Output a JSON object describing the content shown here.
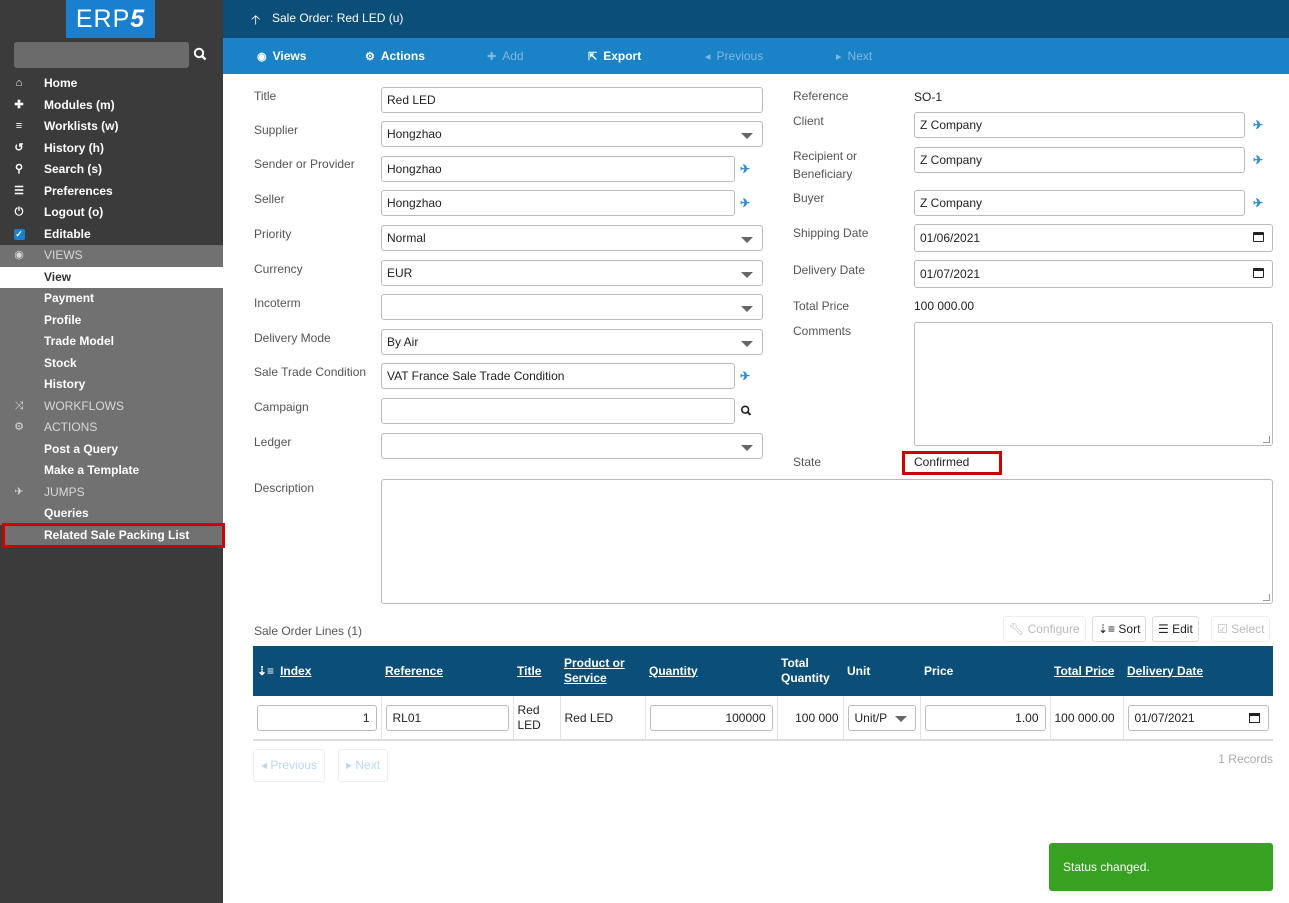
{
  "logo": {
    "text_main": "ERP",
    "text_accent": "5"
  },
  "sidebar": {
    "search_placeholder": "",
    "items": [
      {
        "label": "Home",
        "icon": "home-icon",
        "glyph": "⌂"
      },
      {
        "label": "Modules (m)",
        "icon": "puzzle-icon",
        "glyph": "✚"
      },
      {
        "label": "Worklists (w)",
        "icon": "worklist-icon",
        "glyph": "≡"
      },
      {
        "label": "History (h)",
        "icon": "history-icon",
        "glyph": "↺"
      },
      {
        "label": "Search (s)",
        "icon": "search-icon",
        "glyph": "⚲"
      },
      {
        "label": "Preferences",
        "icon": "sliders-icon",
        "glyph": "☰"
      },
      {
        "label": "Logout (o)",
        "icon": "power-icon",
        "glyph": "⏻"
      },
      {
        "label": "Editable",
        "icon": "checkbox-icon",
        "glyph": "✓"
      }
    ],
    "views_section": {
      "label": "VIEWS",
      "icon": "eye-icon",
      "glyph": "◉"
    },
    "views": [
      "View",
      "Payment",
      "Profile",
      "Trade Model",
      "Stock",
      "History"
    ],
    "workflows_section": {
      "label": "WORKFLOWS",
      "icon": "shuffle-icon",
      "glyph": "⤨"
    },
    "actions_section": {
      "label": "ACTIONS",
      "icon": "gears-icon",
      "glyph": "⚙"
    },
    "actions": [
      "Post a Query",
      "Make a Template"
    ],
    "jumps_section": {
      "label": "JUMPS",
      "icon": "plane-icon",
      "glyph": "✈"
    },
    "jumps": [
      "Queries",
      "Related Sale Packing List"
    ]
  },
  "header": {
    "title": "Sale Order: Red LED (u)"
  },
  "toolbar": {
    "views": "Views",
    "actions": "Actions",
    "add": "Add",
    "export": "Export",
    "previous": "Previous",
    "next": "Next"
  },
  "form": {
    "left": {
      "title": {
        "label": "Title",
        "value": "Red LED"
      },
      "supplier": {
        "label": "Supplier",
        "value": "Hongzhao"
      },
      "sender": {
        "label": "Sender or Provider",
        "value": "Hongzhao"
      },
      "seller": {
        "label": "Seller",
        "value": "Hongzhao"
      },
      "priority": {
        "label": "Priority",
        "value": "Normal"
      },
      "currency": {
        "label": "Currency",
        "value": "EUR"
      },
      "incoterm": {
        "label": "Incoterm",
        "value": ""
      },
      "delivery_mode": {
        "label": "Delivery Mode",
        "value": "By Air"
      },
      "trade_condition": {
        "label": "Sale Trade Condition",
        "value": "VAT France Sale Trade Condition"
      },
      "campaign": {
        "label": "Campaign",
        "value": ""
      },
      "ledger": {
        "label": "Ledger",
        "value": ""
      },
      "description": {
        "label": "Description",
        "value": ""
      }
    },
    "right": {
      "reference": {
        "label": "Reference",
        "value": "SO-1"
      },
      "client": {
        "label": "Client",
        "value": "Z Company"
      },
      "recipient": {
        "label_1": "Recipient or",
        "label_2": "Beneficiary",
        "value": "Z Company"
      },
      "buyer": {
        "label": "Buyer",
        "value": "Z Company"
      },
      "shipping_date": {
        "label": "Shipping Date",
        "value": "01/06/2021"
      },
      "delivery_date": {
        "label": "Delivery Date",
        "value": "01/07/2021"
      },
      "total_price": {
        "label": "Total Price",
        "value": "100 000.00"
      },
      "comments": {
        "label": "Comments",
        "value": ""
      },
      "state": {
        "label": "State",
        "value": "Confirmed"
      }
    }
  },
  "lines": {
    "title": "Sale Order Lines (1)",
    "buttons": {
      "configure": "Configure",
      "sort": "Sort",
      "edit": "Edit",
      "select": "Select"
    },
    "columns": [
      "Index",
      "Reference",
      "Title",
      "Product or Service",
      "Quantity",
      "Total Quantity",
      "Unit",
      "Price",
      "Total Price",
      "Delivery Date"
    ],
    "rows": [
      {
        "index": "1",
        "reference": "RL01",
        "title": "Red LED",
        "product": "Red LED",
        "quantity": "100000",
        "total_quantity": "100 000",
        "unit": "Unit/P",
        "price": "1.00",
        "total_price": "100 000.00",
        "delivery_date": "01/07/2021"
      }
    ],
    "pagination": {
      "previous": "Previous",
      "next": "Next",
      "records": "1 Records"
    }
  },
  "notification": {
    "message": "Status changed.",
    "color": "#37a121"
  },
  "colors": {
    "header": "#0b4f79",
    "toolbar": "#1a82c7",
    "sidebar": "#3b3b3b",
    "highlight": "#cc0000"
  }
}
